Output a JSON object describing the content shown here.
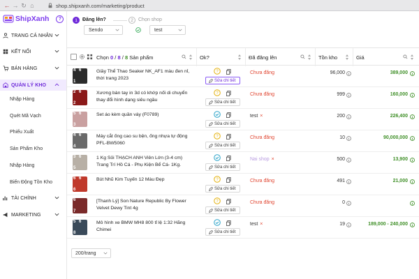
{
  "browser": {
    "url": "shop.shipxanh.com/marketing/product"
  },
  "brand": {
    "name": "ShipXanh",
    "help_glyph": "?"
  },
  "sidebar": {
    "items": [
      {
        "label": "TRANG CÁ NHÂN",
        "icon": "user-icon"
      },
      {
        "label": "KẾT NỐI",
        "icon": "link-icon"
      },
      {
        "label": "BÁN HÀNG",
        "icon": "cart-icon"
      },
      {
        "label": "QUẢN LÝ KHO",
        "icon": "warehouse-icon",
        "active": true
      },
      {
        "label": "TÀI CHÍNH",
        "icon": "finance-icon"
      },
      {
        "label": "MARKETING",
        "icon": "marketing-icon"
      }
    ],
    "subitems": [
      "Nhập Hàng",
      "Quét Mã Vạch",
      "Phiếu Xuất",
      "Sản Phẩm Kho",
      "Nhập Hàng",
      "Biến Động Tồn Kho"
    ]
  },
  "steps": {
    "step1": {
      "number": "1",
      "title": "Đăng lên?",
      "select_value": "Sendo"
    },
    "step2": {
      "number": "2",
      "title": "Chọn shop",
      "select_value": "test"
    }
  },
  "table": {
    "header": {
      "select_prefix": "Chọn",
      "selected": "0",
      "sep1": "/",
      "shown": "8",
      "sep2": "/",
      "total": "8",
      "suffix": "Sản phẩm",
      "ok": "Ok?",
      "posted": "Đã đăng lên",
      "stock": "Tồn kho",
      "price": "Giá"
    },
    "edit_label": "Sửa chi tiết",
    "rows": [
      {
        "name": "Giầy Thể Thao Seaker NK_AF1 màu đen nỉ, thời trang 2023",
        "count_a": "4",
        "count_b": "6",
        "idx": "1",
        "ok": "question",
        "status": "Chưa đăng",
        "status_type": "red",
        "stock": "96,000",
        "price": "389,000",
        "edit_highlight": true
      },
      {
        "name": "Xương bàn tay in 3d có khớp nối di chuyển thay đổi hình dạng siêu ngầu",
        "count_a": "2",
        "count_b": "6",
        "idx": "2",
        "ok": "question",
        "status": "Chưa đăng",
        "status_type": "red",
        "stock": "999",
        "price": "160,000"
      },
      {
        "name": "Set áo kèm quần váy (F0789)",
        "count_a": "5",
        "count_b": "6",
        "idx": "3",
        "ok": "check",
        "status": "test",
        "status_type": "shop",
        "stock": "200",
        "price": "226,400"
      },
      {
        "name": "Máy cắt ống cao su bện, ống nhựa tự động PFL-BW5060",
        "count_a": "4",
        "count_b": "6",
        "idx": "4",
        "ok": "question",
        "status": "Chưa đăng",
        "status_type": "red",
        "stock": "10",
        "price": "90,000,000"
      },
      {
        "name": "1 Kg Sỏi THẠCH ANH Viên Lớn (3-4 cm) Trang Trí Hồ Cá - Phụ Kiện Bể Cá- 1Kg.",
        "count_a": "3",
        "count_b": "6",
        "idx": "5",
        "ok": "check",
        "status": "Nai shop",
        "status_type": "muted",
        "stock": "500",
        "price": "13,900"
      },
      {
        "name": "Bút Nhũ Kim Tuyến 12 Màu Đẹp",
        "count_a": "6",
        "count_b": "6",
        "idx": "6",
        "ok": "question",
        "status": "Chưa đăng",
        "status_type": "red",
        "stock": "491",
        "price": "21,000"
      },
      {
        "name": "[Thanh Lý] Son Nature Republic By Flower Velvet Dewy Tint 4g",
        "count_a": "6",
        "count_b": "",
        "idx": "7",
        "ok": "question",
        "status": "Chưa đăng",
        "status_type": "red",
        "stock": "0",
        "price": ""
      },
      {
        "name": "Mô hình xe BMW MH8 800 tỉ lệ 1:32 Hãng Chimei",
        "count_a": "5",
        "count_b": "6",
        "idx": "8",
        "ok": "check",
        "status": "test",
        "status_type": "shop",
        "stock": "19",
        "price": "189,000 - 240,000"
      }
    ]
  },
  "pager": {
    "value": "200/trang"
  },
  "colors": {
    "accent": "#6d28d9",
    "price_green": "#3f8f27",
    "status_red": "#e0442f",
    "check_teal": "#2aa3c9",
    "question_yellow": "#e4b10c"
  }
}
